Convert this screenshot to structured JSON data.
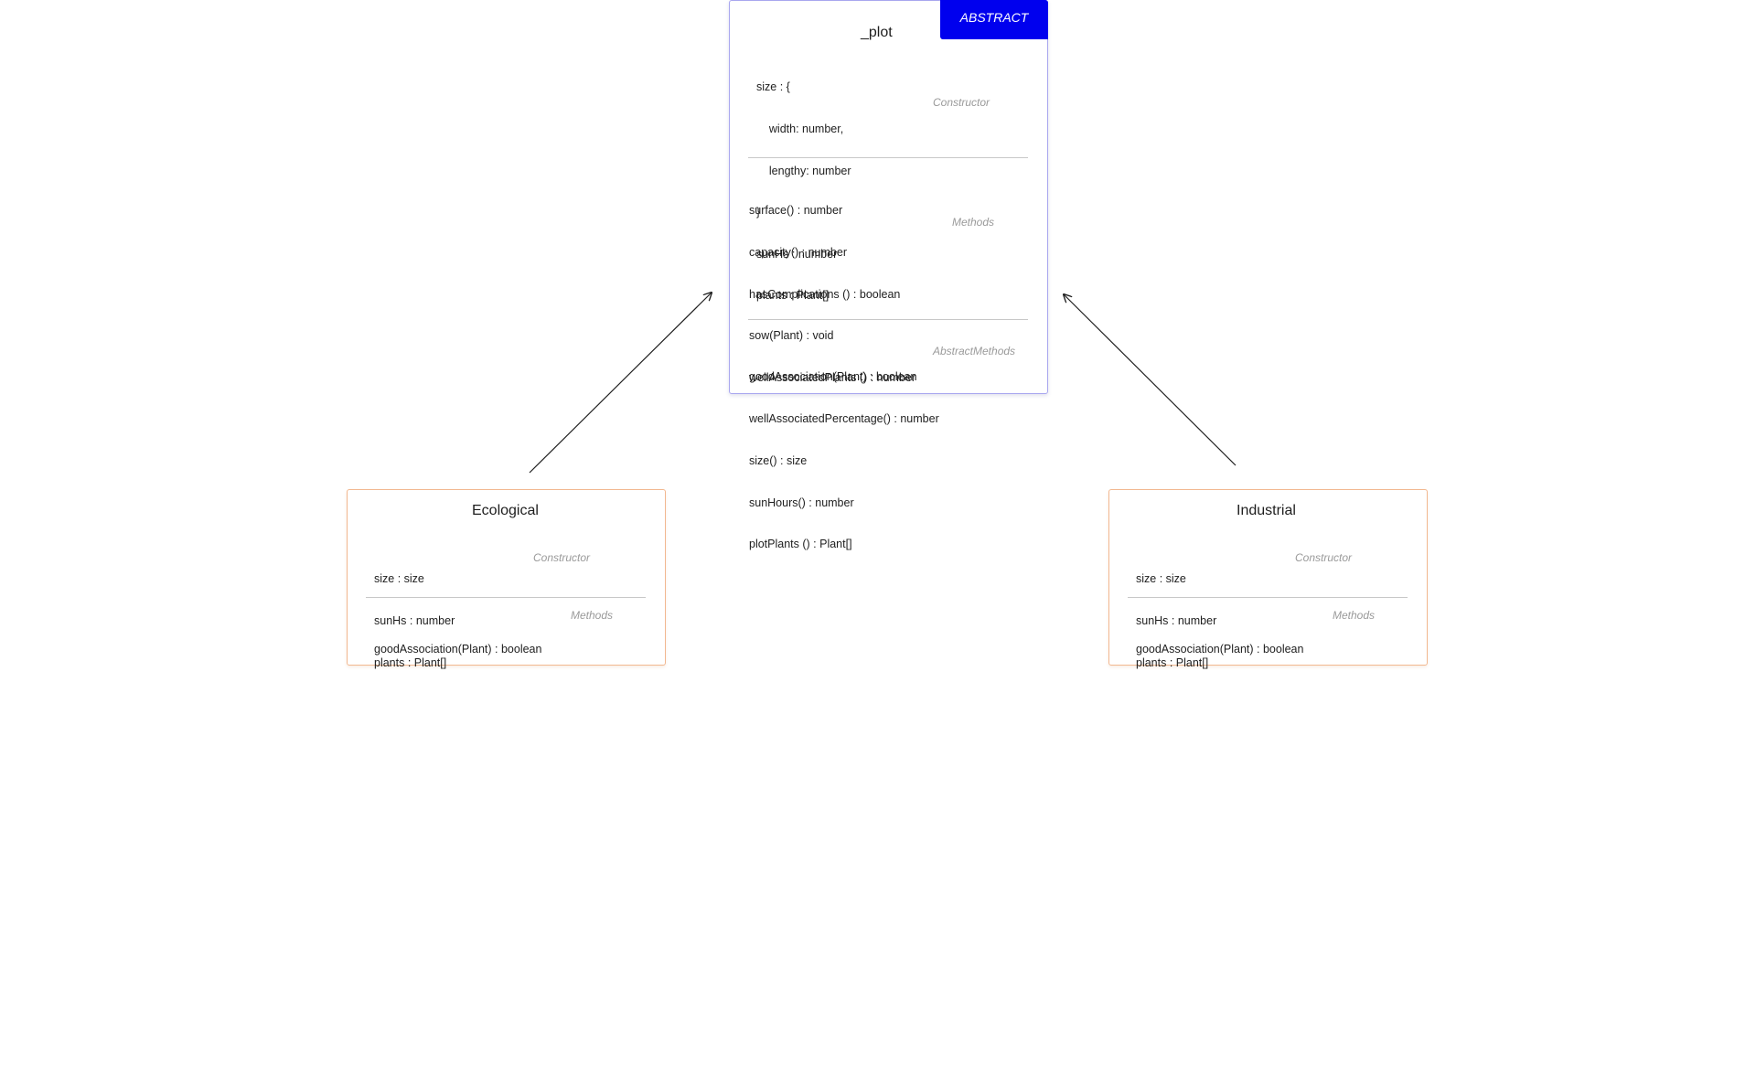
{
  "abstract_class": {
    "badge": "ABSTRACT",
    "title": "_plot",
    "constructor_lines": [
      "size : {",
      "    width: number,",
      "    lengthy: number",
      "}",
      "sunHs : number",
      "plants : Plant[]"
    ],
    "constructor_note": "Constructor",
    "method_lines": [
      "surface() : number",
      "capacity() : number",
      "hasComplications () : boolean",
      "sow(Plant) : void",
      "wellAssociatedPlants () : number",
      "wellAssociatedPercentage() : number",
      "size() : size",
      "sunHours() : number",
      "plotPlants () : Plant[]"
    ],
    "methods_note": "Methods",
    "abstract_method_lines": [
      "goodAssociation(Plant) : boolean"
    ],
    "abstract_methods_note": "AbstractMethods"
  },
  "ecological": {
    "title": "Ecological",
    "constructor_lines": [
      "size : size",
      "sunHs : number",
      "plants : Plant[]"
    ],
    "constructor_note": "Constructor",
    "method_lines": [
      "goodAssociation(Plant) : boolean"
    ],
    "methods_note": "Methods"
  },
  "industrial": {
    "title": "Industrial",
    "constructor_lines": [
      "size : size",
      "sunHs : number",
      "plants : Plant[]"
    ],
    "constructor_note": "Constructor",
    "method_lines": [
      "goodAssociation(Plant) : boolean"
    ],
    "methods_note": "Methods"
  },
  "colors": {
    "abstract_border": "#a9a7ef",
    "badge_bg": "#0000ee",
    "subclass_border": "#f2b890",
    "note_text": "#9a9a9a"
  }
}
